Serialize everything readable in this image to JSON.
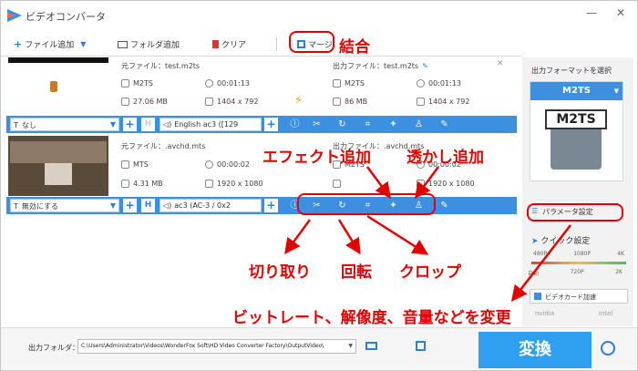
{
  "window": {
    "title": "ビデオコンバータ",
    "minimize": "—",
    "close": "✕"
  },
  "toolbar": {
    "add_file": "ファイル追加",
    "add_folder": "フォルダ追加",
    "clear": "クリア",
    "merge": "マージ"
  },
  "files": [
    {
      "src_name": "元ファイル：test.m2ts",
      "src_format": "M2TS",
      "src_duration": "00:01:13",
      "src_size": "27.06 MB",
      "src_res": "1404 x 792",
      "out_name": "出力ファイル：test.m2ts",
      "out_format": "M2TS",
      "out_duration": "00:01:13",
      "out_size": "86 MB",
      "out_res": "1404 x 792",
      "subtitle": "なし",
      "audio": "English ac3 ([129"
    },
    {
      "src_name": "元ファイル：.avchd.mts",
      "src_format": "MTS",
      "src_duration": "00:00:02",
      "src_size": "4.31 MB",
      "src_res": "1920 x 1080",
      "out_name": "出力ファイル：.avchd.mts",
      "out_format": "M2TS",
      "out_duration": "00:00:02",
      "out_size": "",
      "out_res": "1920 x 1080",
      "subtitle": "無効にする",
      "audio": "ac3 (AC-3 / 0x2"
    }
  ],
  "rightpanel": {
    "header": "出力フォーマットを選択",
    "format": "M2TS",
    "format_badge": "M2TS",
    "param_settings": "パラメータ設定",
    "quick_settings": "クイック設定",
    "quality_top": [
      "480P",
      "1080P",
      "4K"
    ],
    "quality_bottom": [
      "自動",
      "720P",
      "2K"
    ],
    "gpu": "ビデオカード加速",
    "nvidia": "nvidia",
    "intel": "intel"
  },
  "bottom": {
    "output_folder_label": "出力フォルダ：",
    "output_path": "C:\\Users\\Administrator\\Videos\\WonderFox Soft\\HD Video Converter Factory\\OutputVideo\\",
    "convert": "変換"
  },
  "annotations": {
    "merge": "結合",
    "effect": "エフェクト追加",
    "watermark": "透かし追加",
    "cut": "切り取り",
    "rotate": "回転",
    "crop": "クロップ",
    "params": "ビットレート、解像度、音量などを変更"
  },
  "colors": {
    "accent": "#3d8fe0",
    "annotation": "#e30000",
    "convert_bg": "#2fa0f0"
  }
}
